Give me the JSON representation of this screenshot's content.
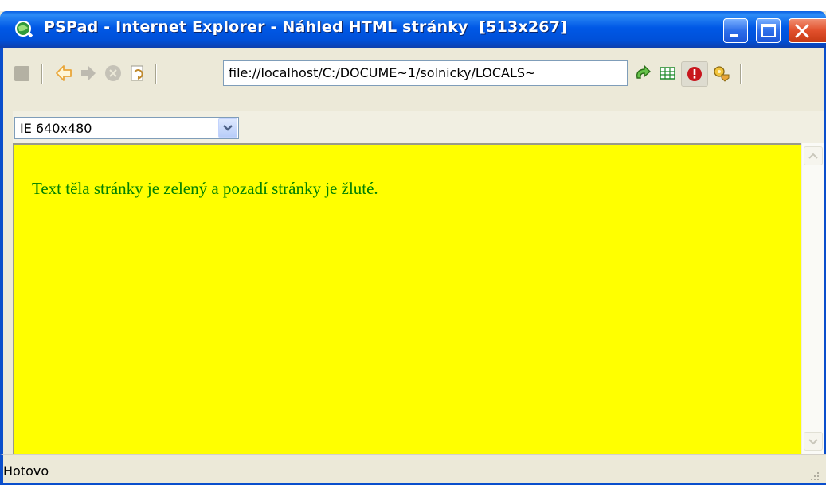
{
  "window": {
    "title": "PSPad - Internet Explorer - Náhled HTML stránky  [513x267]",
    "icon": "pspad-globe-icon"
  },
  "toolbar": {
    "address": "file://localhost/C:/DOCUME~1/solnicky/LOCALS~",
    "icons": [
      "stop-square-icon",
      "back-arrow-icon",
      "forward-arrow-icon",
      "stop-icon",
      "refresh-icon",
      "go-icon",
      "table-icon",
      "error-icon",
      "options-icon"
    ]
  },
  "view": {
    "size_option": "IE 640x480"
  },
  "page": {
    "body_text": "Text těla stránky je zelený a pozadí stránky je žluté.",
    "background_color": "#ffff00",
    "text_color": "#008000"
  },
  "status": {
    "text": "Hotovo"
  }
}
